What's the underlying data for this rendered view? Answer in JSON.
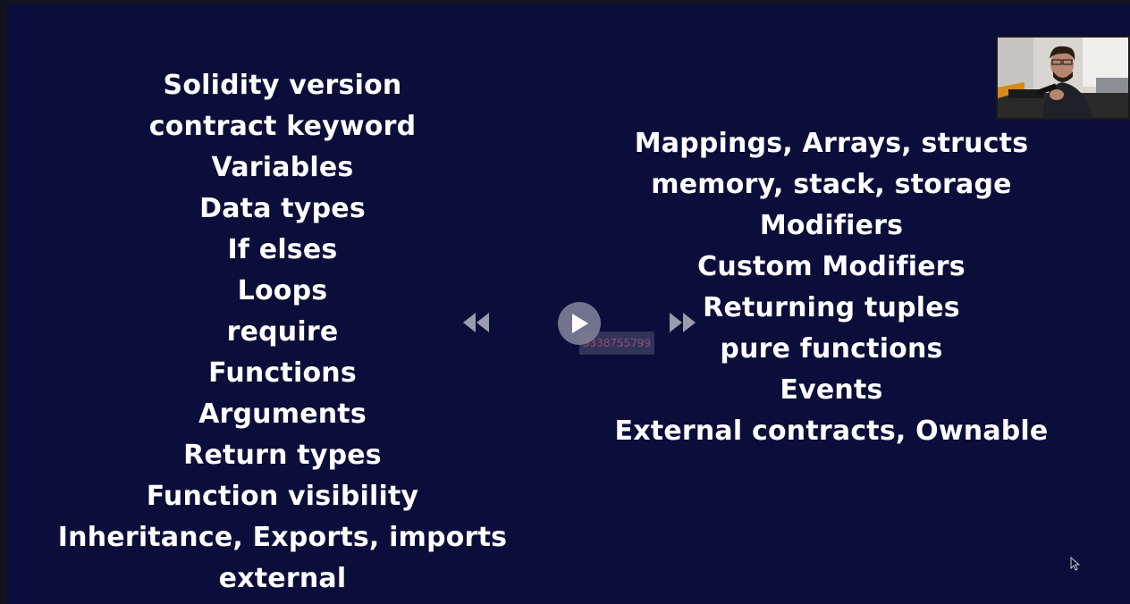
{
  "left_topics": [
    "Solidity version",
    "contract keyword",
    "Variables",
    "Data types",
    "If elses",
    "Loops",
    "require",
    "Functions",
    "Arguments",
    "Return types",
    "Function visibility",
    "Inheritance, Exports, imports",
    "external"
  ],
  "right_topics": [
    "Mappings, Arrays, structs",
    "memory, stack, storage",
    "Modifiers",
    "Custom Modifiers",
    "Returning tuples",
    "pure functions",
    "Events",
    "External contracts, Ownable"
  ],
  "player": {
    "watermark_text": "3338755799",
    "rewind_icon": "rewind-icon",
    "play_icon": "play-icon",
    "forward_icon": "fast-forward-icon"
  },
  "colors": {
    "background": "#0b0d3a",
    "text": "#ffffff"
  }
}
